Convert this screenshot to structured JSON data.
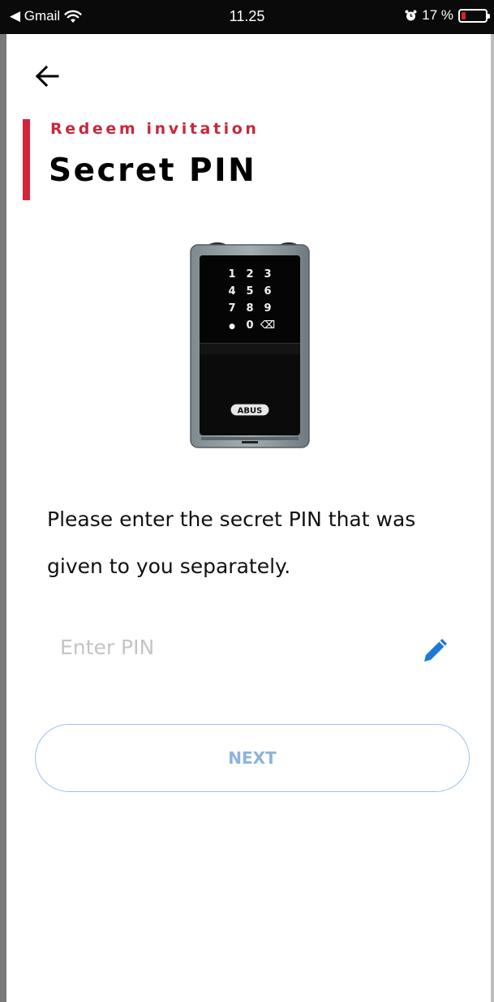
{
  "status_bar": {
    "back_app": "◀ Gmail",
    "time": "11.25",
    "battery_percent": "17 %",
    "battery_level": 0.17,
    "battery_color": "#e01e2b"
  },
  "header": {
    "back_icon": "arrow-left-icon",
    "eyebrow": "Redeem invitation",
    "title": "Secret PIN",
    "accent_color": "#d5243a"
  },
  "device": {
    "keypad": [
      "1",
      "2",
      "3",
      "4",
      "5",
      "6",
      "7",
      "8",
      "9",
      "●",
      "0",
      "⌫"
    ],
    "brand": "ABUS"
  },
  "instruction": "Please enter the secret PIN that was given to you separately.",
  "pin_field": {
    "value": "",
    "placeholder": "Enter PIN",
    "edit_icon": "pencil-icon",
    "icon_color": "#1f7ad6"
  },
  "next_button": {
    "label": "NEXT",
    "color": "#8cb4dd"
  }
}
